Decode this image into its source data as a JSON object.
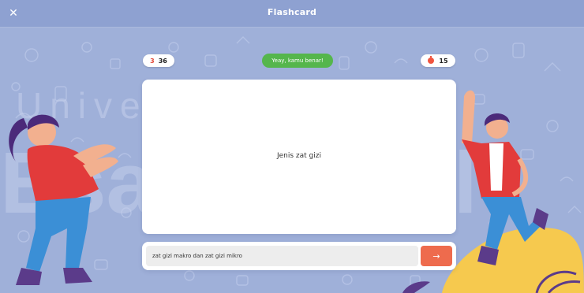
{
  "header": {
    "title": "Flashcard",
    "close_icon": "close-icon"
  },
  "stats": {
    "wrong_count": "3",
    "total_count": "36",
    "timer_icon": "timer-icon",
    "timer_value": "15"
  },
  "feedback": {
    "message": "Yeay, kamu benar!"
  },
  "card": {
    "question": "Jenis zat gizi"
  },
  "answer": {
    "value": "zat gizi makro dan zat gizi mikro",
    "submit_icon": "arrow-right-icon"
  },
  "watermark": {
    "line1": "Universitas",
    "line2": "Esa Unggul"
  },
  "colors": {
    "background": "#9fb0d9",
    "header": "#8ea1d1",
    "success": "#55b64c",
    "accent": "#ee6b4d",
    "wrong": "#e24b3a"
  }
}
